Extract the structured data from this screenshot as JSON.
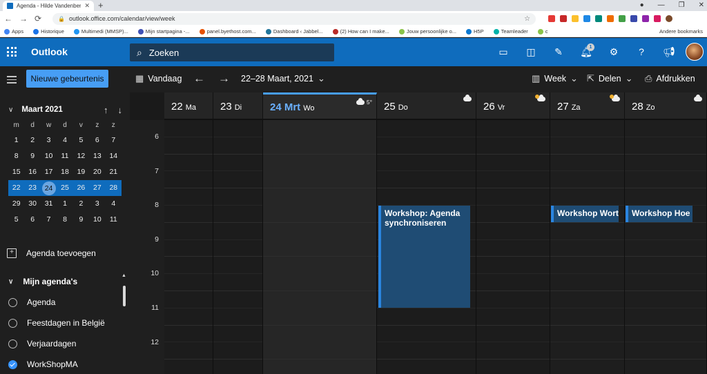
{
  "browser": {
    "tab_title": "Agenda - Hilde Vandenberk - Ou",
    "url": "outlook.office.com/calendar/view/week",
    "bookmarks": [
      {
        "label": "Apps",
        "color": "#4285f4"
      },
      {
        "label": "Historique",
        "color": "#1a73e8"
      },
      {
        "label": "Multimedi (MMSP)...",
        "color": "#2196f3"
      },
      {
        "label": "Mijn startpagina -...",
        "color": "#3f51b5"
      },
      {
        "label": "panel.byethost.com...",
        "color": "#e65100"
      },
      {
        "label": "Dashboard ‹ Jabbel...",
        "color": "#21759b"
      },
      {
        "label": "(2) How can I make...",
        "color": "#b92b27"
      },
      {
        "label": "Jouw persoonlijke o...",
        "color": "#8bc34a"
      },
      {
        "label": "H5P",
        "color": "#0a78d1"
      },
      {
        "label": "Teamleader",
        "color": "#00b2a9"
      },
      {
        "label": "c",
        "color": "#8bc34a"
      }
    ],
    "other_bookmarks": "Andere bookmarks"
  },
  "header": {
    "app_name": "Outlook",
    "search_placeholder": "Zoeken",
    "notification_count": "1"
  },
  "leftpane": {
    "new_event": "Nieuwe gebeurtenis",
    "month_title": "Maart 2021",
    "weekdays": [
      "m",
      "d",
      "w",
      "d",
      "v",
      "z",
      "z"
    ],
    "weeks": [
      [
        "1",
        "2",
        "3",
        "4",
        "5",
        "6",
        "7"
      ],
      [
        "8",
        "9",
        "10",
        "11",
        "12",
        "13",
        "14"
      ],
      [
        "15",
        "16",
        "17",
        "18",
        "19",
        "20",
        "21"
      ],
      [
        "22",
        "23",
        "24",
        "25",
        "26",
        "27",
        "28"
      ],
      [
        "29",
        "30",
        "31",
        "1",
        "2",
        "3",
        "4"
      ],
      [
        "5",
        "6",
        "7",
        "8",
        "9",
        "10",
        "11"
      ]
    ],
    "add_calendar": "Agenda toevoegen",
    "my_calendars": "Mijn agenda's",
    "calendars": [
      {
        "name": "Agenda",
        "checked": false
      },
      {
        "name": "Feestdagen in België",
        "checked": false
      },
      {
        "name": "Verjaardagen",
        "checked": false
      },
      {
        "name": "WorkShopMA",
        "checked": true
      }
    ]
  },
  "toolbar": {
    "today": "Vandaag",
    "range": "22–28 Maart, 2021",
    "view": "Week",
    "share": "Delen",
    "print": "Afdrukken"
  },
  "calendar": {
    "days": [
      {
        "num": "22",
        "name": "Ma",
        "weather": ""
      },
      {
        "num": "23",
        "name": "Di",
        "weather": ""
      },
      {
        "num": "24 Mrt",
        "name": "Wo",
        "weather": "5°",
        "today": true
      },
      {
        "num": "25",
        "name": "Do",
        "weather": ""
      },
      {
        "num": "26",
        "name": "Vr",
        "weather": ""
      },
      {
        "num": "27",
        "name": "Za",
        "weather": ""
      },
      {
        "num": "28",
        "name": "Zo",
        "weather": ""
      }
    ],
    "hours": [
      "6",
      "7",
      "8",
      "9",
      "10",
      "11",
      "12"
    ],
    "events": [
      {
        "title": "Workshop: Agenda synchroniseren",
        "day": "25 Do"
      },
      {
        "title": "Workshop Wort",
        "day": "27 Za"
      },
      {
        "title": "Workshop Hoe",
        "day": "28 Zo"
      }
    ]
  }
}
